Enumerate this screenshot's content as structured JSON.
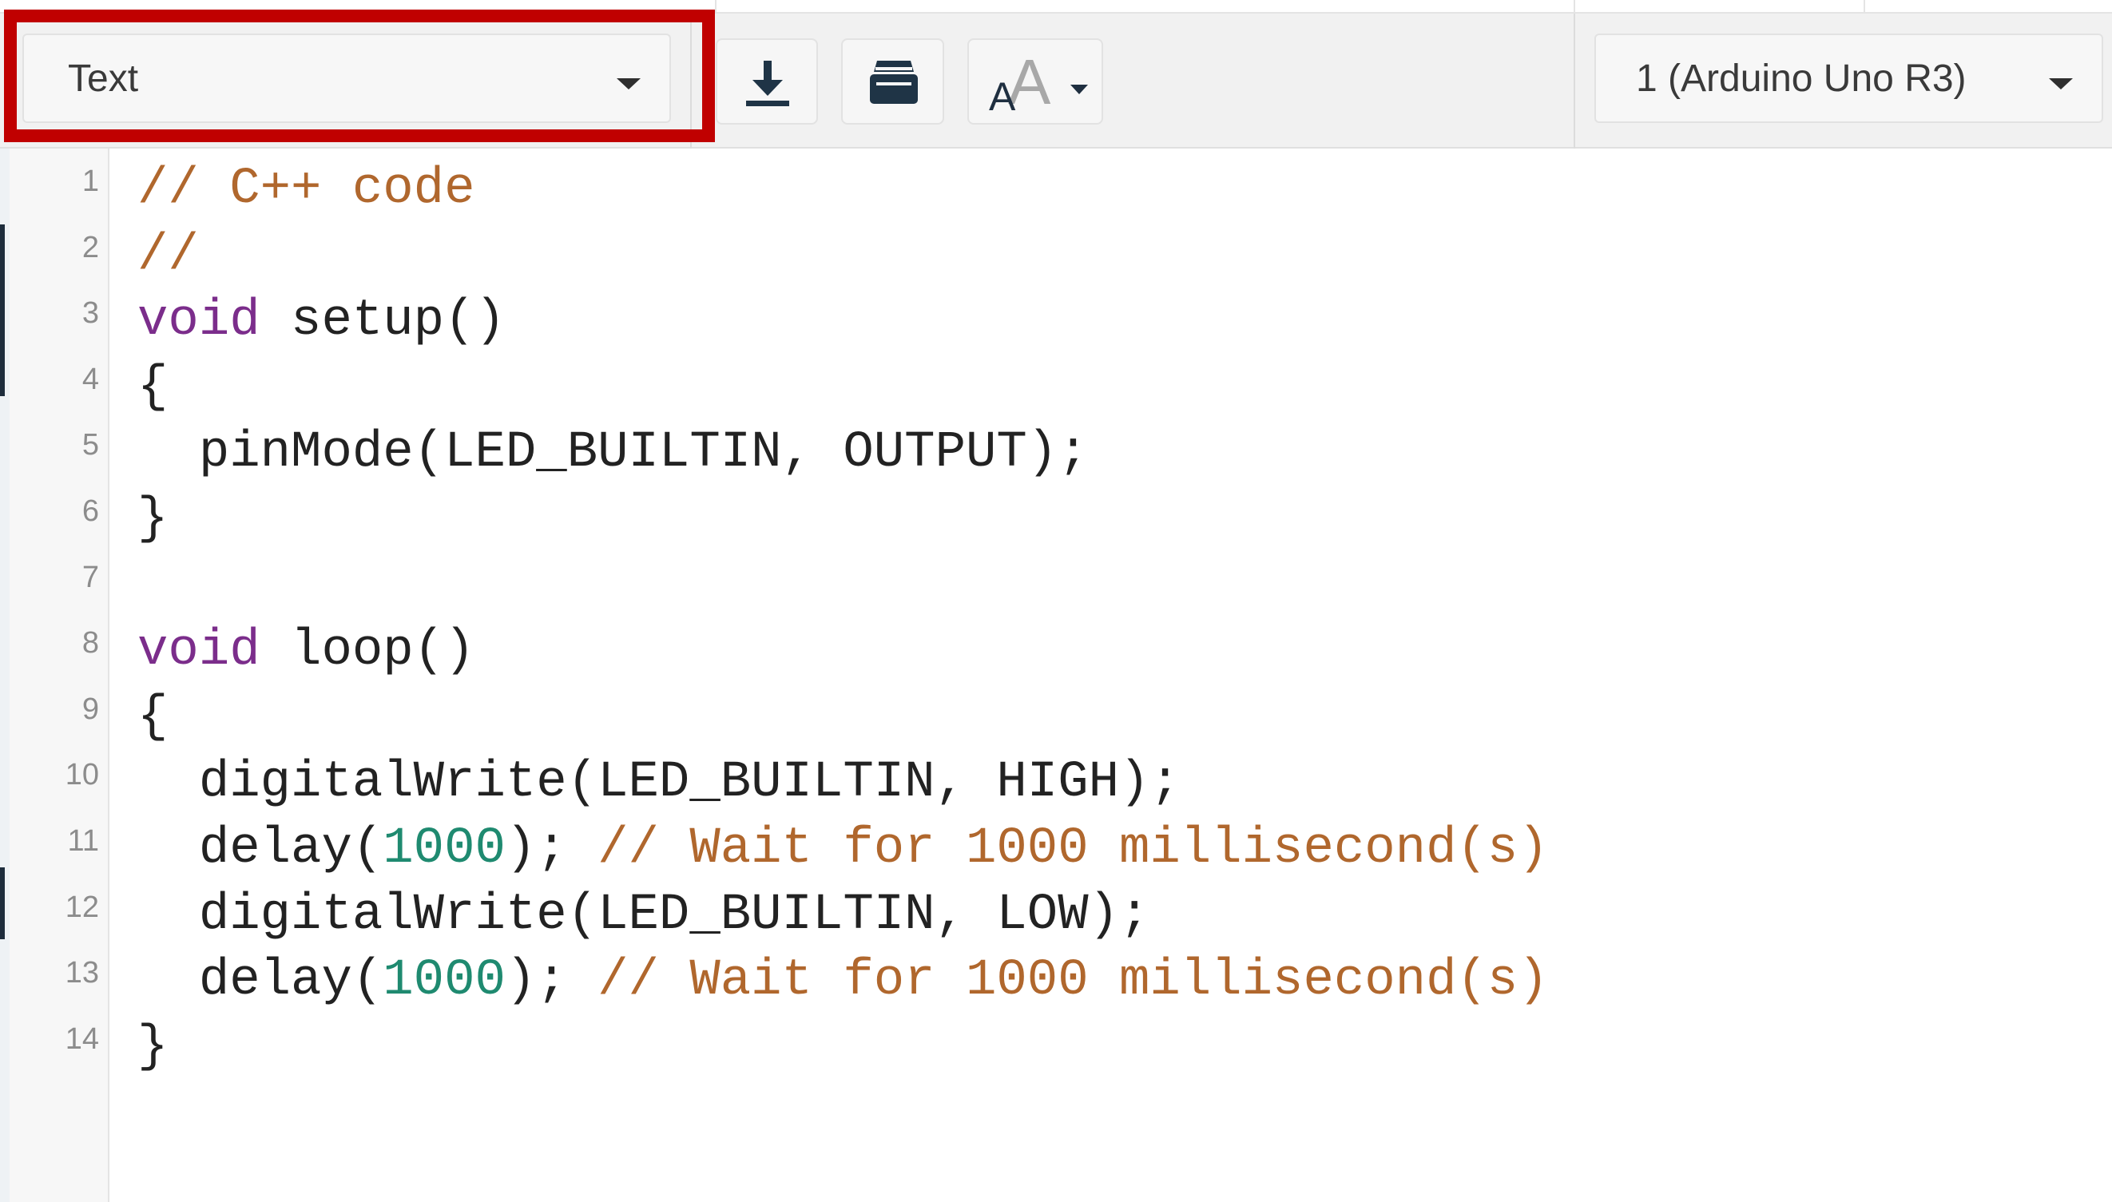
{
  "toolbar": {
    "mode_dropdown": {
      "selected": "Text"
    },
    "board_dropdown": {
      "selected": "1 (Arduino Uno R3)"
    },
    "download_icon": "download-icon",
    "library_icon": "library-icon",
    "fontsize_icon": "font-size-icon"
  },
  "editor": {
    "lines": [
      {
        "number": "1",
        "tokens": [
          {
            "type": "comment",
            "text": "// C++ code"
          }
        ]
      },
      {
        "number": "2",
        "tokens": [
          {
            "type": "comment",
            "text": "//"
          }
        ]
      },
      {
        "number": "3",
        "tokens": [
          {
            "type": "keyword",
            "text": "void"
          },
          {
            "type": "plain",
            "text": " setup()"
          }
        ]
      },
      {
        "number": "4",
        "tokens": [
          {
            "type": "plain",
            "text": "{"
          }
        ]
      },
      {
        "number": "5",
        "tokens": [
          {
            "type": "plain",
            "text": "  pinMode(LED_BUILTIN, OUTPUT);"
          }
        ]
      },
      {
        "number": "6",
        "tokens": [
          {
            "type": "plain",
            "text": "}"
          }
        ]
      },
      {
        "number": "7",
        "tokens": []
      },
      {
        "number": "8",
        "tokens": [
          {
            "type": "keyword",
            "text": "void"
          },
          {
            "type": "plain",
            "text": " loop()"
          }
        ]
      },
      {
        "number": "9",
        "tokens": [
          {
            "type": "plain",
            "text": "{"
          }
        ]
      },
      {
        "number": "10",
        "tokens": [
          {
            "type": "plain",
            "text": "  digitalWrite(LED_BUILTIN, HIGH);"
          }
        ]
      },
      {
        "number": "11",
        "tokens": [
          {
            "type": "plain",
            "text": "  delay("
          },
          {
            "type": "number",
            "text": "1000"
          },
          {
            "type": "plain",
            "text": "); "
          },
          {
            "type": "comment",
            "text": "// Wait for 1000 millisecond(s)"
          }
        ]
      },
      {
        "number": "12",
        "tokens": [
          {
            "type": "plain",
            "text": "  digitalWrite(LED_BUILTIN, LOW);"
          }
        ]
      },
      {
        "number": "13",
        "tokens": [
          {
            "type": "plain",
            "text": "  delay("
          },
          {
            "type": "number",
            "text": "1000"
          },
          {
            "type": "plain",
            "text": "); "
          },
          {
            "type": "comment",
            "text": "// Wait for 1000 millisecond(s)"
          }
        ]
      },
      {
        "number": "14",
        "tokens": [
          {
            "type": "plain",
            "text": "}"
          }
        ]
      }
    ]
  },
  "colors": {
    "keyword": "#7b2d8b",
    "comment": "#b0672d",
    "number": "#1f8a70",
    "plain": "#222222",
    "highlight": "#c00000",
    "line_number": "#8c8c8c"
  }
}
